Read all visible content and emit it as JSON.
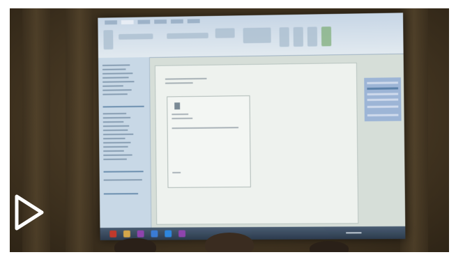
{
  "media": {
    "kind": "video-thumbnail",
    "play_icon": "play-icon",
    "play_color": "#ffffff"
  },
  "scene": {
    "projected_screen": {
      "taskbar_icons": [
        "start-icon",
        "explorer-icon",
        "onenote-icon",
        "app-icon",
        "app-icon",
        "app-icon"
      ]
    }
  }
}
